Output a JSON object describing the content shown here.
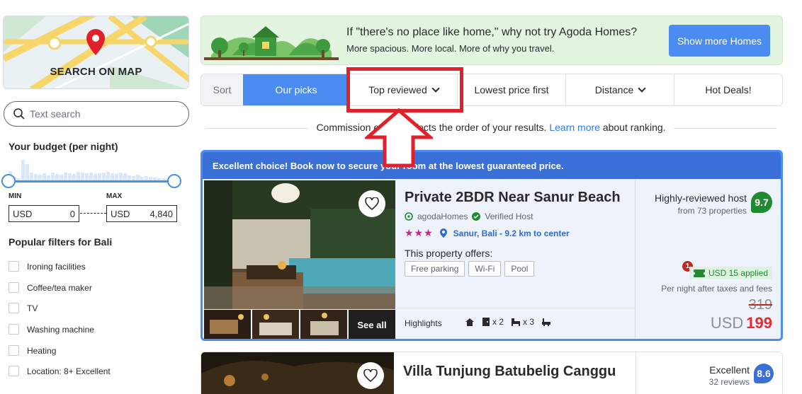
{
  "map": {
    "label": "SEARCH ON MAP"
  },
  "search": {
    "placeholder": "Text search"
  },
  "budget": {
    "title": "Your budget (per night)",
    "min_label": "MIN",
    "max_label": "MAX",
    "min_currency": "USD",
    "min_value": "0",
    "max_currency": "USD",
    "max_value": "4,840",
    "slider_min_fraction": 0,
    "slider_max_fraction": 1
  },
  "popular": {
    "title": "Popular filters for Bali",
    "items": [
      {
        "label": "Ironing facilities"
      },
      {
        "label": "Coffee/tea maker"
      },
      {
        "label": "TV"
      },
      {
        "label": "Washing machine"
      },
      {
        "label": "Heating"
      },
      {
        "label": "Location: 8+ Excellent"
      }
    ]
  },
  "banner": {
    "title": "If \"there's no place like home,\" why not try Agoda Homes?",
    "subtitle": "More spacious. More local. More of why you travel.",
    "button": "Show more Homes"
  },
  "sort": {
    "label": "Sort",
    "options": [
      {
        "label": "Our picks",
        "active": true
      },
      {
        "label": "Top reviewed",
        "dropdown": true
      },
      {
        "label": "Lowest price first"
      },
      {
        "label": "Distance",
        "dropdown": true
      },
      {
        "label": "Hot Deals!"
      }
    ]
  },
  "commission": {
    "text_before": "Commission earned affects the order of your results.",
    "link": "Learn more",
    "text_after": "about ranking."
  },
  "card1": {
    "banner": "Excellent choice! Book now to secure your room at the lowest guaranteed price.",
    "name": "Private 2BDR Near Sanur Beach",
    "brand": "agodaHomes",
    "verified": "Verified Host",
    "stars": "★★★",
    "location": "Sanur, Bali - 9.2 km to center",
    "offers_title": "This property offers:",
    "offers": [
      "Free parking",
      "Wi-Fi",
      "Pool"
    ],
    "see_all": "See all",
    "highlights": "Highlights",
    "amenities": {
      "bedrooms": "x 2",
      "beds": "x 3"
    },
    "host_title": "Highly-reviewed host",
    "host_sub": "from 73 properties",
    "score": "9.7",
    "coupon_count": "1",
    "coupon": "USD 15 applied",
    "per_night": "Per night after taxes and fees",
    "old_price": "319",
    "currency": "USD",
    "price": "199"
  },
  "card2": {
    "name": "Villa Tunjung Batubelig Canggu",
    "rating_word": "Excellent",
    "reviews": "32 reviews",
    "score": "8.6"
  },
  "colors": {
    "accent": "#4a8cf0",
    "annotation_red": "#e2202a",
    "score_green": "#1f8a2e",
    "price_red": "#e12d2d"
  }
}
